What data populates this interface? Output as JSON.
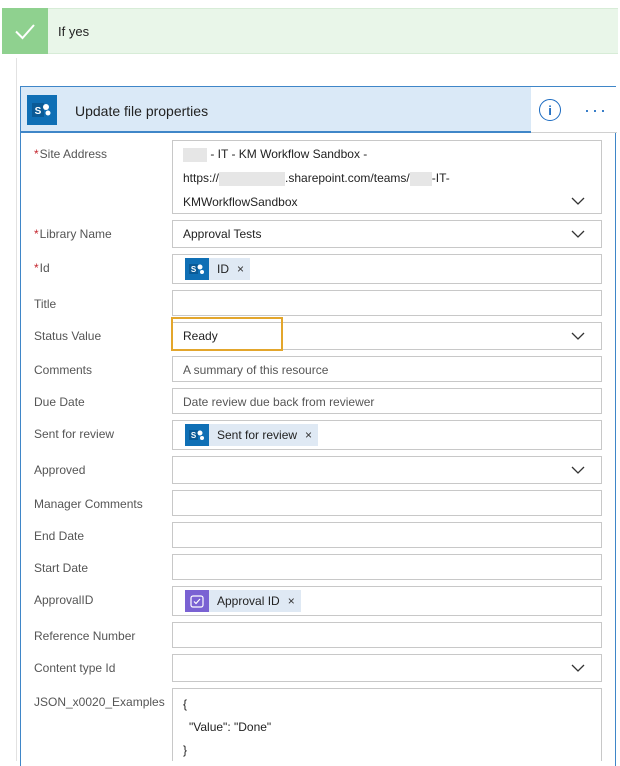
{
  "condition": {
    "title": "If yes"
  },
  "action": {
    "title": "Update file properties"
  },
  "fields": {
    "site_address": {
      "label": "Site Address",
      "line1": "- IT - KM Workflow Sandbox -",
      "line2a": "https://",
      "line2b": ".sharepoint.com/teams/",
      "line2c": "-IT-",
      "line3": "KMWorkflowSandbox"
    },
    "library_name": {
      "label": "Library Name",
      "value": "Approval Tests"
    },
    "id": {
      "label": "Id",
      "token": "ID"
    },
    "title": {
      "label": "Title"
    },
    "status_value": {
      "label": "Status Value",
      "value": "Ready"
    },
    "comments": {
      "label": "Comments",
      "placeholder": "A summary of this resource"
    },
    "due_date": {
      "label": "Due Date",
      "placeholder": "Date review due back from reviewer"
    },
    "sent_for_review": {
      "label": "Sent for review",
      "token": "Sent for review"
    },
    "approved": {
      "label": "Approved"
    },
    "manager_comments": {
      "label": "Manager Comments"
    },
    "end_date": {
      "label": "End Date"
    },
    "start_date": {
      "label": "Start Date"
    },
    "approval_id": {
      "label": "ApprovalID",
      "token": "Approval ID"
    },
    "reference_number": {
      "label": "Reference Number"
    },
    "content_type_id": {
      "label": "Content type Id"
    },
    "json_examples": {
      "label": "JSON_x0020_Examples",
      "line1": "{",
      "line2": "\"Value\": \"Done\"",
      "line3": "}"
    }
  },
  "token_remove_glyph": "×",
  "required_mark": "*",
  "colors": {
    "accent": "#3f86c8",
    "sharepoint": "#0f6fb5",
    "approval": "#7a62d3",
    "success": "#8fd18f",
    "highlight": "#e3a62c"
  }
}
